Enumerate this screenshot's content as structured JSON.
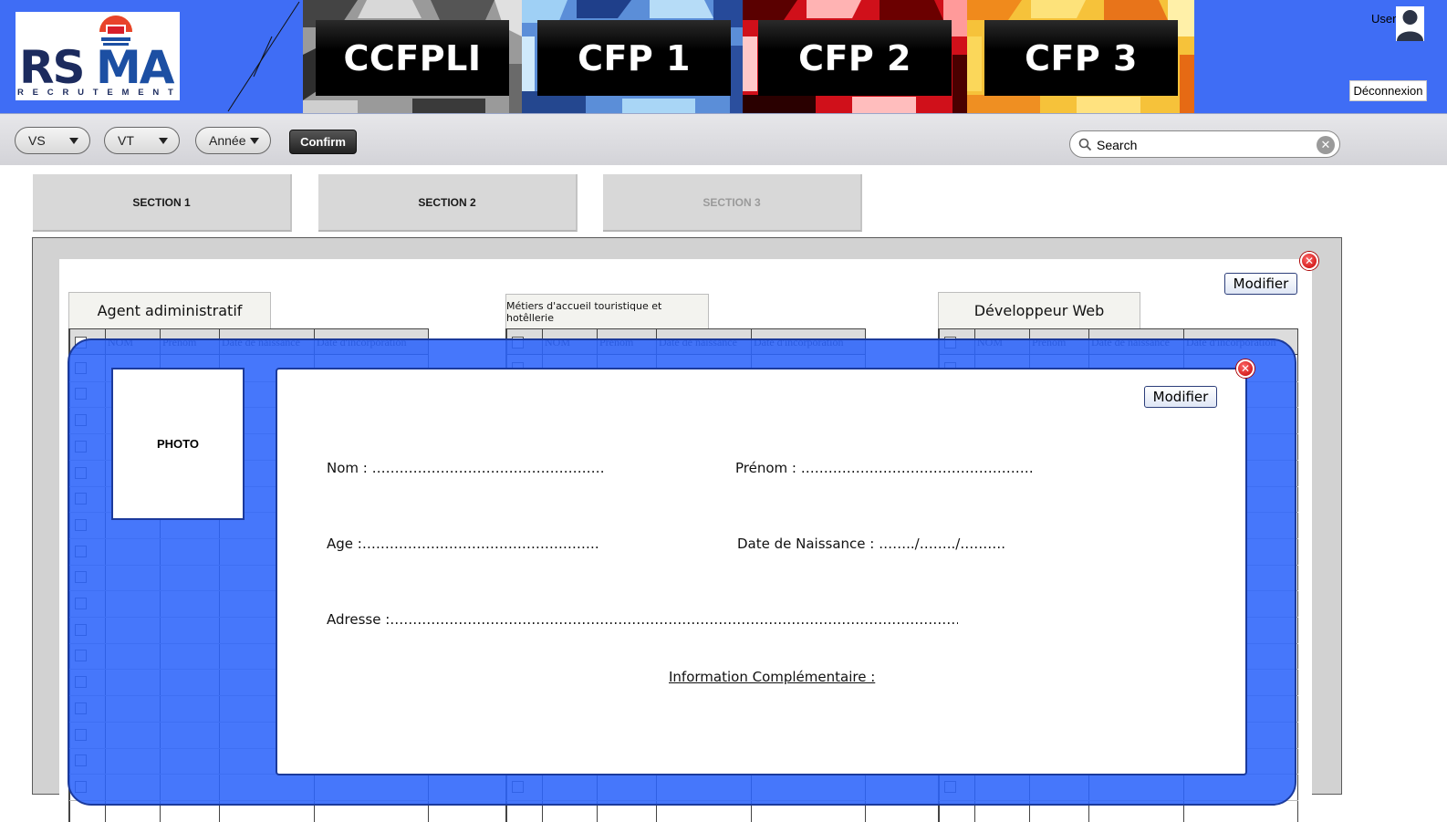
{
  "header": {
    "logo_text": "RSMA",
    "logo_subtitle": "RECRUTEMENT",
    "centers": [
      {
        "label": "CCFPLI",
        "camo": "grey"
      },
      {
        "label": "CFP 1",
        "camo": "blue"
      },
      {
        "label": "CFP 2",
        "camo": "red"
      },
      {
        "label": "CFP 3",
        "camo": "yellow"
      }
    ],
    "user_label": "User",
    "logout_label": "Déconnexion",
    "accent_color": "#3f6df5"
  },
  "toolbar": {
    "filters": [
      {
        "label": "VS"
      },
      {
        "label": "VT"
      },
      {
        "label": "Année"
      }
    ],
    "confirm_label": "Confirm",
    "search_value": "Search",
    "search_icon": "search-icon",
    "clear_icon": "clear-icon"
  },
  "sections": [
    {
      "label": "SECTION 1",
      "enabled": true
    },
    {
      "label": "SECTION 2",
      "enabled": true
    },
    {
      "label": "SECTION 3",
      "enabled": false
    }
  ],
  "panel": {
    "modify_label": "Modifier",
    "close_icon": "close-icon",
    "jobs": [
      {
        "title": "Agent adiministratif"
      },
      {
        "title": "Métiers d'accueil touristique et hotêllerie"
      },
      {
        "title": "Développeur Web"
      }
    ],
    "table_columns": [
      "NOM",
      "Prénom",
      "Date de naissance",
      "Date d'incorporation"
    ]
  },
  "detail": {
    "photo_label": "PHOTO",
    "modify_label": "Modifier",
    "fields": {
      "nom": "Nom : ……………………………………………",
      "prenom": "Prénom : ……………………………………………",
      "age": "Age :…………………………………………….",
      "naissance": "Date de Naissance : ……../……../……….",
      "adresse": "Adresse :……………………………………………………………………………………………………………………………"
    },
    "info_label": "Information Complémentaire :"
  }
}
